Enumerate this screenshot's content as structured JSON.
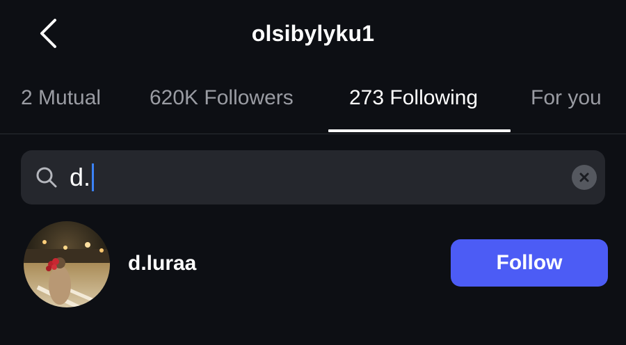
{
  "header": {
    "title": "olsibylyku1",
    "back_icon": "chevron-left-icon"
  },
  "tabs": [
    {
      "label": "2 Mutual",
      "active": false
    },
    {
      "label": "620K Followers",
      "active": false
    },
    {
      "label": "273 Following",
      "active": true
    },
    {
      "label": "For you",
      "active": false
    }
  ],
  "search": {
    "value": "d.",
    "icon": "search-icon",
    "clear_icon": "clear-icon"
  },
  "results": [
    {
      "username": "d.luraa",
      "button_label": "Follow"
    }
  ],
  "colors": {
    "background": "#0d0f14",
    "follow_button": "#4c5cf5",
    "caret": "#3b82f6",
    "search_bg": "#25272d",
    "inactive_tab": "#9a9ca3"
  }
}
